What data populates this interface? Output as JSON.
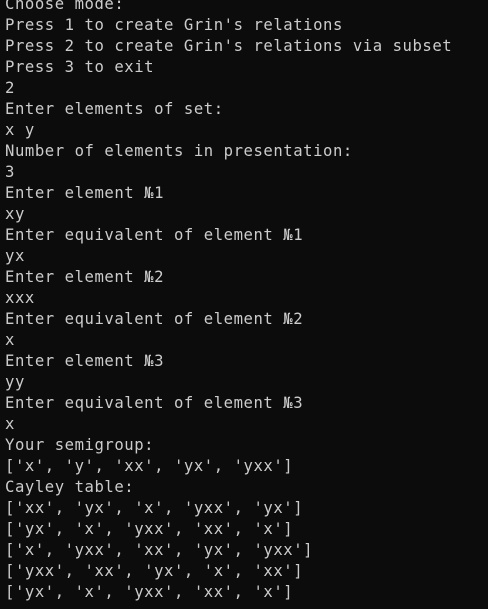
{
  "console": {
    "lines": [
      "Choose mode:",
      "Press 1 to create Grin's relations",
      "Press 2 to create Grin's relations via subset",
      "Press 3 to exit",
      "2",
      "Enter elements of set:",
      "x y",
      "Number of elements in presentation:",
      "3",
      "Enter element №1",
      "xy",
      "Enter equivalent of element №1",
      "yx",
      "Enter element №2",
      "xxx",
      "Enter equivalent of element №2",
      "x",
      "Enter element №3",
      "yy",
      "Enter equivalent of element №3",
      "x",
      "Your semigroup:",
      "['x', 'y', 'xx', 'yx', 'yxx']",
      "Cayley table:",
      "['xx', 'yx', 'x', 'yxx', 'yx']",
      "['yx', 'x', 'yxx', 'xx', 'x']",
      "['x', 'yxx', 'xx', 'yx', 'yxx']",
      "['yxx', 'xx', 'yx', 'x', 'xx']",
      "['yx', 'x', 'yxx', 'xx', 'x']"
    ]
  },
  "colors": {
    "background": "#0c0c0c",
    "text": "#cccccc"
  }
}
